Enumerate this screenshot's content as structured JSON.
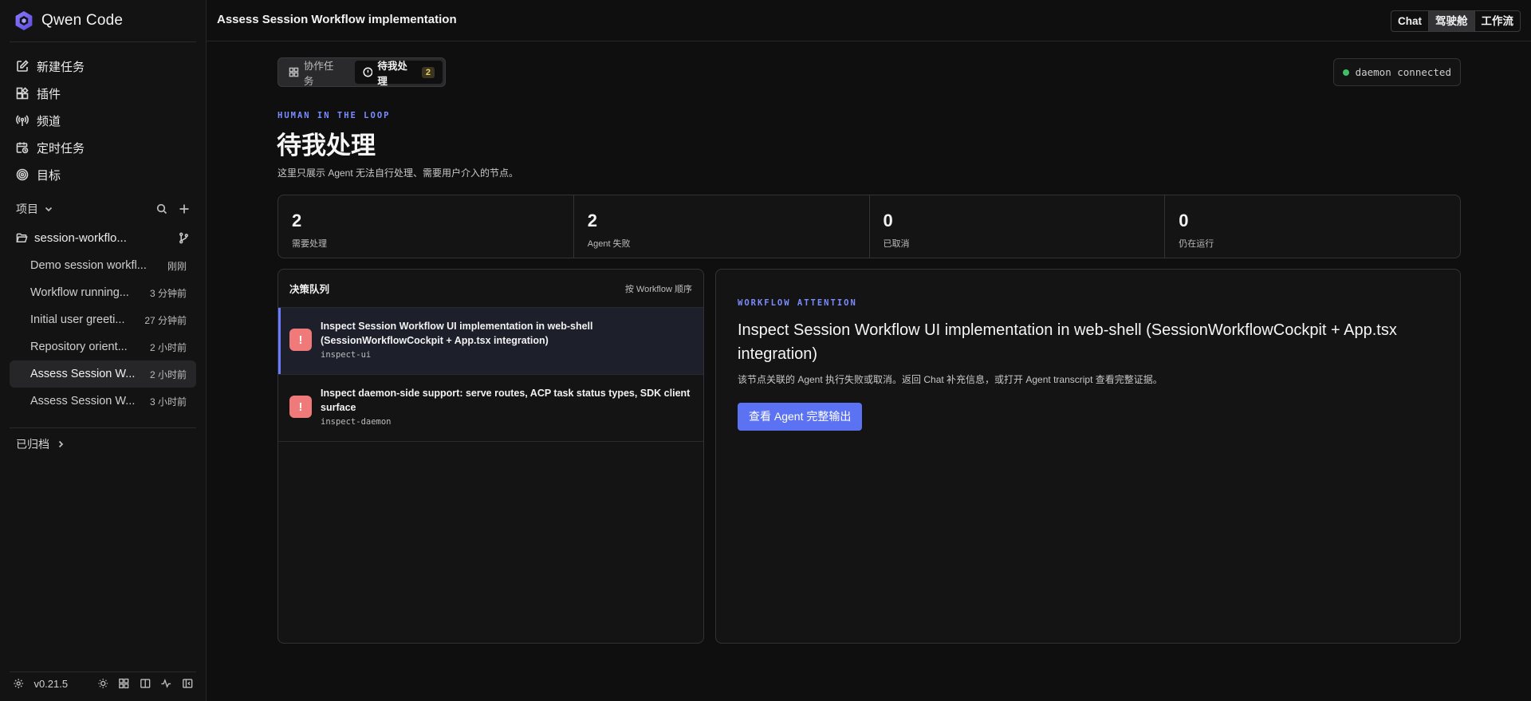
{
  "app": {
    "name": "Qwen Code"
  },
  "nav": [
    {
      "label": "新建任务",
      "icon": "edit-icon"
    },
    {
      "label": "插件",
      "icon": "plugin-icon"
    },
    {
      "label": "频道",
      "icon": "broadcast-icon"
    },
    {
      "label": "定时任务",
      "icon": "calendar-clock-icon"
    },
    {
      "label": "目标",
      "icon": "target-icon"
    }
  ],
  "projects": {
    "label": "项目",
    "folder": "session-workflo..."
  },
  "sessions": [
    {
      "title": "Demo session workfl...",
      "time": "刚刚"
    },
    {
      "title": "Workflow running...",
      "time": "3 分钟前"
    },
    {
      "title": "Initial user greeti...",
      "time": "27 分钟前"
    },
    {
      "title": "Repository orient...",
      "time": "2 小时前"
    },
    {
      "title": "Assess Session W...",
      "time": "2 小时前",
      "active": true
    },
    {
      "title": "Assess Session W...",
      "time": "3 小时前"
    }
  ],
  "archived_label": "已归档",
  "footer": {
    "version": "v0.21.5"
  },
  "topbar": {
    "title": "Assess Session Workflow implementation",
    "modes": [
      "Chat",
      "驾驶舱",
      "工作流"
    ],
    "active_mode": "驾驶舱"
  },
  "tabs": {
    "collab": "协作任务",
    "pending": "待我处理",
    "pending_count": "2"
  },
  "daemon_status": "daemon connected",
  "header": {
    "eyebrow": "HUMAN IN THE LOOP",
    "title": "待我处理",
    "desc": "这里只展示 Agent 无法自行处理、需要用户介入的节点。"
  },
  "stats": [
    {
      "value": "2",
      "label": "需要处理"
    },
    {
      "value": "2",
      "label": "Agent 失败"
    },
    {
      "value": "0",
      "label": "已取消"
    },
    {
      "value": "0",
      "label": "仍在运行"
    }
  ],
  "queue": {
    "title": "决策队列",
    "sort": "按 Workflow 顺序",
    "items": [
      {
        "title": "Inspect Session Workflow UI implementation in web-shell (SessionWorkflowCockpit + App.tsx integration)",
        "id": "inspect-ui",
        "icon": "!"
      },
      {
        "title": "Inspect daemon-side support: serve routes, ACP task status types, SDK client surface",
        "id": "inspect-daemon",
        "icon": "!"
      }
    ]
  },
  "detail": {
    "eyebrow": "WORKFLOW ATTENTION",
    "title": "Inspect Session Workflow UI implementation in web-shell (SessionWorkflowCockpit + App.tsx integration)",
    "desc": "该节点关联的 Agent 执行失败或取消。返回 Chat 补充信息，或打开 Agent transcript 查看完整证据。",
    "button": "查看 Agent 完整输出"
  },
  "colors": {
    "accent": "#5b73f2",
    "warning": "#f07a7a",
    "connected": "#3fbf6a"
  }
}
